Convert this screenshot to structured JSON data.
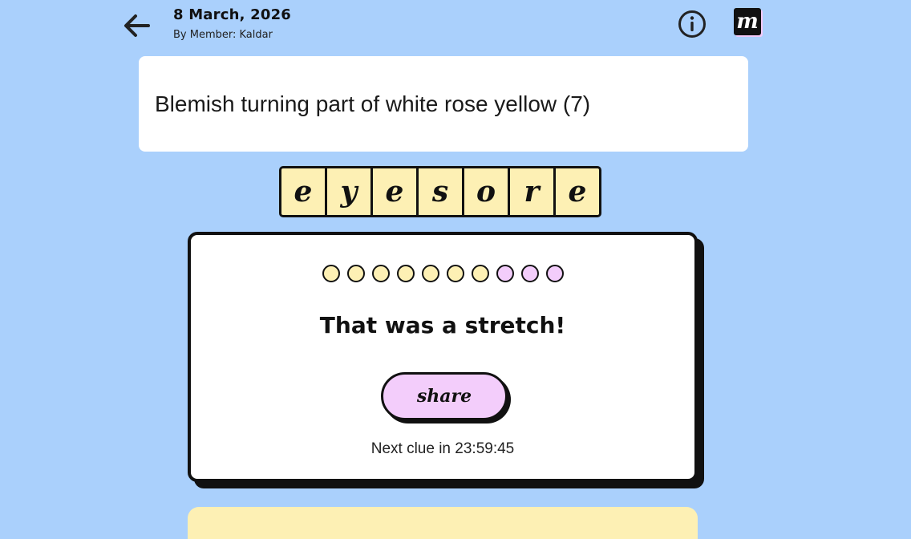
{
  "header": {
    "date": "8 March, 2026",
    "author": "By Member: Kaldar",
    "logo_letter": "m"
  },
  "icons": {
    "back": "arrow-left-icon",
    "info": "info-circle-icon",
    "logo": "minute-cryptic-logo"
  },
  "clue": {
    "text": "Blemish turning part of white rose yellow (7)"
  },
  "answer": {
    "letters": [
      "e",
      "y",
      "e",
      "s",
      "o",
      "r",
      "e"
    ]
  },
  "result": {
    "dots": [
      "yellow",
      "yellow",
      "yellow",
      "yellow",
      "yellow",
      "yellow",
      "yellow",
      "pink",
      "pink",
      "pink"
    ],
    "message": "That was a stretch!",
    "share_label": "share",
    "next_clue": "Next clue in 23:59:45"
  },
  "colors": {
    "background": "#aad0fc",
    "yellow": "#fdf0b4",
    "pink": "#f3cdfb",
    "ink": "#111111"
  }
}
